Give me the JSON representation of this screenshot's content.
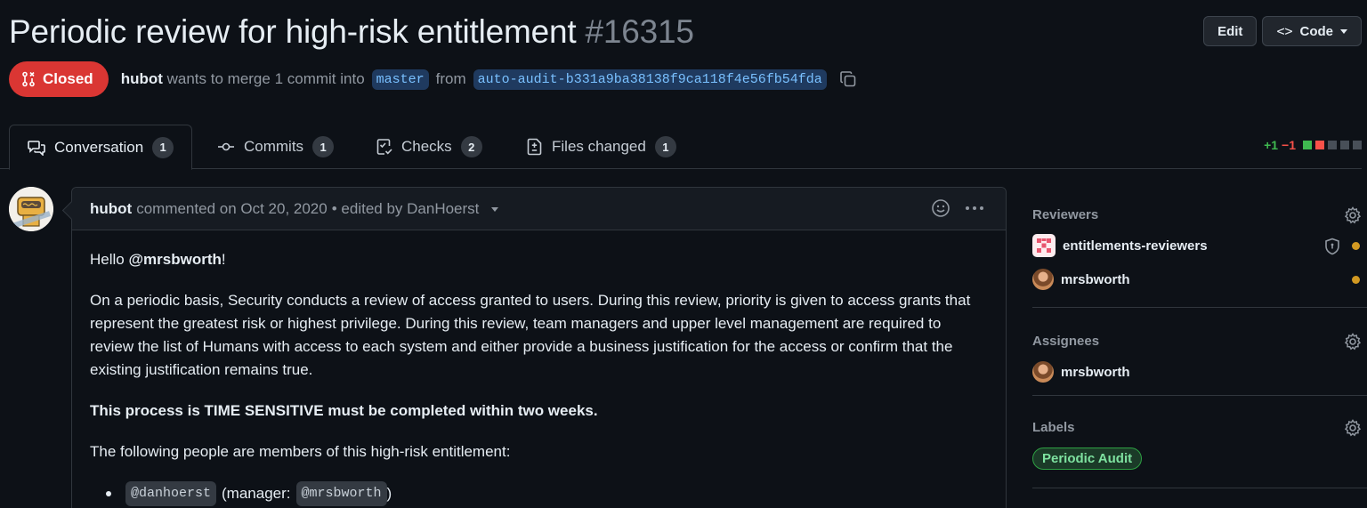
{
  "pr": {
    "title": "Periodic review for high-risk entitlement",
    "number": "#16315",
    "state": "Closed",
    "author": "hubot",
    "merge_text": "wants to merge 1 commit into",
    "base_branch": "master",
    "from_text": "from",
    "head_branch": "auto-audit-b331a9ba38138f9ca118f4e56fb54fda"
  },
  "header_actions": {
    "edit_label": "Edit",
    "code_label": "Code"
  },
  "tabs": [
    {
      "label": "Conversation",
      "count": "1",
      "icon": "comment-discussion-icon"
    },
    {
      "label": "Commits",
      "count": "1",
      "icon": "git-commit-icon"
    },
    {
      "label": "Checks",
      "count": "2",
      "icon": "checklist-icon"
    },
    {
      "label": "Files changed",
      "count": "1",
      "icon": "file-diff-icon"
    }
  ],
  "diffstat": {
    "additions": "+1",
    "deletions": "−1",
    "colors": {
      "add": "#3fb950",
      "del": "#f85149",
      "neutral": "#484f58"
    }
  },
  "comment": {
    "author": "hubot",
    "action": "commented on Oct 20, 2020",
    "edited": "• edited by DanHoerst",
    "greeting_prefix": "Hello ",
    "greeting_mention": "@mrsbworth",
    "greeting_suffix": "!",
    "paragraph": "On a periodic basis, Security conducts a review of access granted to users. During this review, priority is given to access grants that represent the greatest risk or highest privilege. During this review, team managers and upper level management are required to review the list of Humans with access to each system and either provide a business justification for the access or confirm that the existing justification remains true.",
    "warning": "This process is TIME SENSITIVE must be completed within two weeks.",
    "members_intro": "The following people are members of this high-risk entitlement:",
    "members": [
      {
        "user": "@danhoerst",
        "manager_prefix": "(manager:",
        "manager": "@mrsbworth",
        "suffix": ")"
      }
    ]
  },
  "sidebar": {
    "reviewers": {
      "title": "Reviewers",
      "items": [
        {
          "name": "entitlements-reviewers",
          "type": "team"
        },
        {
          "name": "mrsbworth",
          "type": "user"
        }
      ]
    },
    "assignees": {
      "title": "Assignees",
      "items": [
        {
          "name": "mrsbworth"
        }
      ]
    },
    "labels": {
      "title": "Labels",
      "items": [
        {
          "name": "Periodic Audit",
          "color": "#2ea043"
        }
      ]
    }
  }
}
